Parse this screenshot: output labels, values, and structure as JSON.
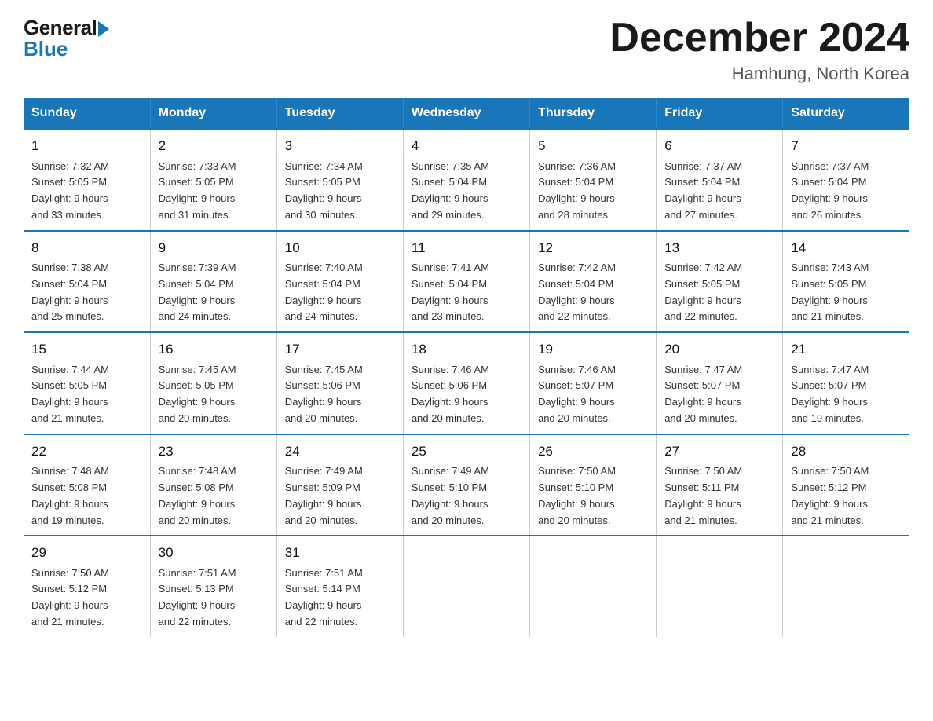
{
  "logo": {
    "general": "General",
    "blue": "Blue"
  },
  "title": "December 2024",
  "subtitle": "Hamhung, North Korea",
  "headers": [
    "Sunday",
    "Monday",
    "Tuesday",
    "Wednesday",
    "Thursday",
    "Friday",
    "Saturday"
  ],
  "weeks": [
    [
      {
        "day": "1",
        "sunrise": "7:32 AM",
        "sunset": "5:05 PM",
        "daylight": "9 hours and 33 minutes."
      },
      {
        "day": "2",
        "sunrise": "7:33 AM",
        "sunset": "5:05 PM",
        "daylight": "9 hours and 31 minutes."
      },
      {
        "day": "3",
        "sunrise": "7:34 AM",
        "sunset": "5:05 PM",
        "daylight": "9 hours and 30 minutes."
      },
      {
        "day": "4",
        "sunrise": "7:35 AM",
        "sunset": "5:04 PM",
        "daylight": "9 hours and 29 minutes."
      },
      {
        "day": "5",
        "sunrise": "7:36 AM",
        "sunset": "5:04 PM",
        "daylight": "9 hours and 28 minutes."
      },
      {
        "day": "6",
        "sunrise": "7:37 AM",
        "sunset": "5:04 PM",
        "daylight": "9 hours and 27 minutes."
      },
      {
        "day": "7",
        "sunrise": "7:37 AM",
        "sunset": "5:04 PM",
        "daylight": "9 hours and 26 minutes."
      }
    ],
    [
      {
        "day": "8",
        "sunrise": "7:38 AM",
        "sunset": "5:04 PM",
        "daylight": "9 hours and 25 minutes."
      },
      {
        "day": "9",
        "sunrise": "7:39 AM",
        "sunset": "5:04 PM",
        "daylight": "9 hours and 24 minutes."
      },
      {
        "day": "10",
        "sunrise": "7:40 AM",
        "sunset": "5:04 PM",
        "daylight": "9 hours and 24 minutes."
      },
      {
        "day": "11",
        "sunrise": "7:41 AM",
        "sunset": "5:04 PM",
        "daylight": "9 hours and 23 minutes."
      },
      {
        "day": "12",
        "sunrise": "7:42 AM",
        "sunset": "5:04 PM",
        "daylight": "9 hours and 22 minutes."
      },
      {
        "day": "13",
        "sunrise": "7:42 AM",
        "sunset": "5:05 PM",
        "daylight": "9 hours and 22 minutes."
      },
      {
        "day": "14",
        "sunrise": "7:43 AM",
        "sunset": "5:05 PM",
        "daylight": "9 hours and 21 minutes."
      }
    ],
    [
      {
        "day": "15",
        "sunrise": "7:44 AM",
        "sunset": "5:05 PM",
        "daylight": "9 hours and 21 minutes."
      },
      {
        "day": "16",
        "sunrise": "7:45 AM",
        "sunset": "5:05 PM",
        "daylight": "9 hours and 20 minutes."
      },
      {
        "day": "17",
        "sunrise": "7:45 AM",
        "sunset": "5:06 PM",
        "daylight": "9 hours and 20 minutes."
      },
      {
        "day": "18",
        "sunrise": "7:46 AM",
        "sunset": "5:06 PM",
        "daylight": "9 hours and 20 minutes."
      },
      {
        "day": "19",
        "sunrise": "7:46 AM",
        "sunset": "5:07 PM",
        "daylight": "9 hours and 20 minutes."
      },
      {
        "day": "20",
        "sunrise": "7:47 AM",
        "sunset": "5:07 PM",
        "daylight": "9 hours and 20 minutes."
      },
      {
        "day": "21",
        "sunrise": "7:47 AM",
        "sunset": "5:07 PM",
        "daylight": "9 hours and 19 minutes."
      }
    ],
    [
      {
        "day": "22",
        "sunrise": "7:48 AM",
        "sunset": "5:08 PM",
        "daylight": "9 hours and 19 minutes."
      },
      {
        "day": "23",
        "sunrise": "7:48 AM",
        "sunset": "5:08 PM",
        "daylight": "9 hours and 20 minutes."
      },
      {
        "day": "24",
        "sunrise": "7:49 AM",
        "sunset": "5:09 PM",
        "daylight": "9 hours and 20 minutes."
      },
      {
        "day": "25",
        "sunrise": "7:49 AM",
        "sunset": "5:10 PM",
        "daylight": "9 hours and 20 minutes."
      },
      {
        "day": "26",
        "sunrise": "7:50 AM",
        "sunset": "5:10 PM",
        "daylight": "9 hours and 20 minutes."
      },
      {
        "day": "27",
        "sunrise": "7:50 AM",
        "sunset": "5:11 PM",
        "daylight": "9 hours and 21 minutes."
      },
      {
        "day": "28",
        "sunrise": "7:50 AM",
        "sunset": "5:12 PM",
        "daylight": "9 hours and 21 minutes."
      }
    ],
    [
      {
        "day": "29",
        "sunrise": "7:50 AM",
        "sunset": "5:12 PM",
        "daylight": "9 hours and 21 minutes."
      },
      {
        "day": "30",
        "sunrise": "7:51 AM",
        "sunset": "5:13 PM",
        "daylight": "9 hours and 22 minutes."
      },
      {
        "day": "31",
        "sunrise": "7:51 AM",
        "sunset": "5:14 PM",
        "daylight": "9 hours and 22 minutes."
      },
      null,
      null,
      null,
      null
    ]
  ],
  "labels": {
    "sunrise": "Sunrise:",
    "sunset": "Sunset:",
    "daylight": "Daylight:"
  }
}
